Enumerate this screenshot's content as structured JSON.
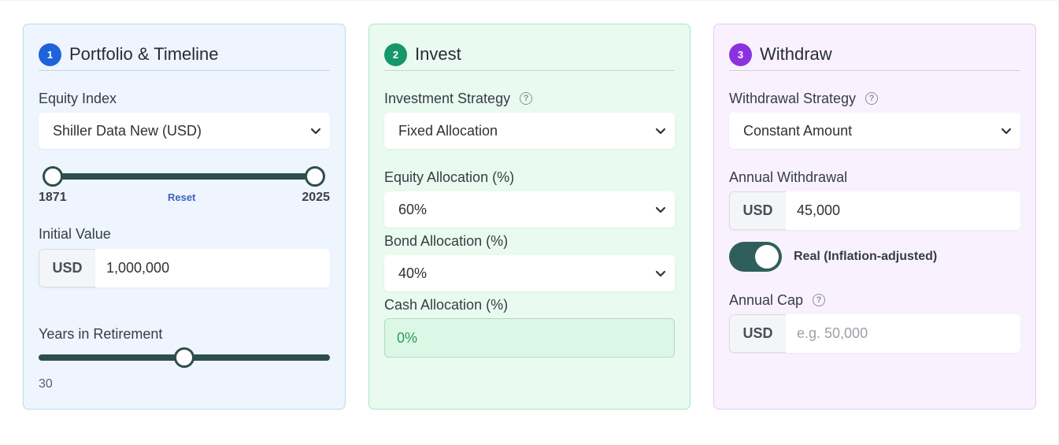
{
  "panels": [
    {
      "step": "1",
      "title": "Portfolio & Timeline",
      "equity_index_label": "Equity Index",
      "equity_index_value": "Shiller Data New (USD)",
      "range_start": "1871",
      "range_end": "2025",
      "reset_label": "Reset",
      "initial_value_label": "Initial Value",
      "initial_value_currency": "USD",
      "initial_value": "1,000,000",
      "years_label": "Years in Retirement",
      "years_value": "30"
    },
    {
      "step": "2",
      "title": "Invest",
      "strategy_label": "Investment Strategy",
      "strategy_value": "Fixed Allocation",
      "equity_alloc_label": "Equity Allocation (%)",
      "equity_alloc_value": "60%",
      "bond_alloc_label": "Bond Allocation (%)",
      "bond_alloc_value": "40%",
      "cash_alloc_label": "Cash Allocation (%)",
      "cash_alloc_value": "0%"
    },
    {
      "step": "3",
      "title": "Withdraw",
      "strategy_label": "Withdrawal Strategy",
      "strategy_value": "Constant Amount",
      "annual_withdrawal_label": "Annual Withdrawal",
      "annual_withdrawal_currency": "USD",
      "annual_withdrawal_value": "45,000",
      "real_toggle_label": "Real (Inflation-adjusted)",
      "real_toggle_on": true,
      "annual_cap_label": "Annual Cap",
      "annual_cap_currency": "USD",
      "annual_cap_placeholder": "e.g. 50,000"
    }
  ],
  "help_glyph": "?",
  "icons": {
    "help": "question-circle-icon",
    "dropdown": "chevron-down-icon"
  },
  "colors": {
    "step1": "#1f63db",
    "step2": "#14976b",
    "step3": "#8b32e0",
    "slider": "#2e4e4b"
  }
}
